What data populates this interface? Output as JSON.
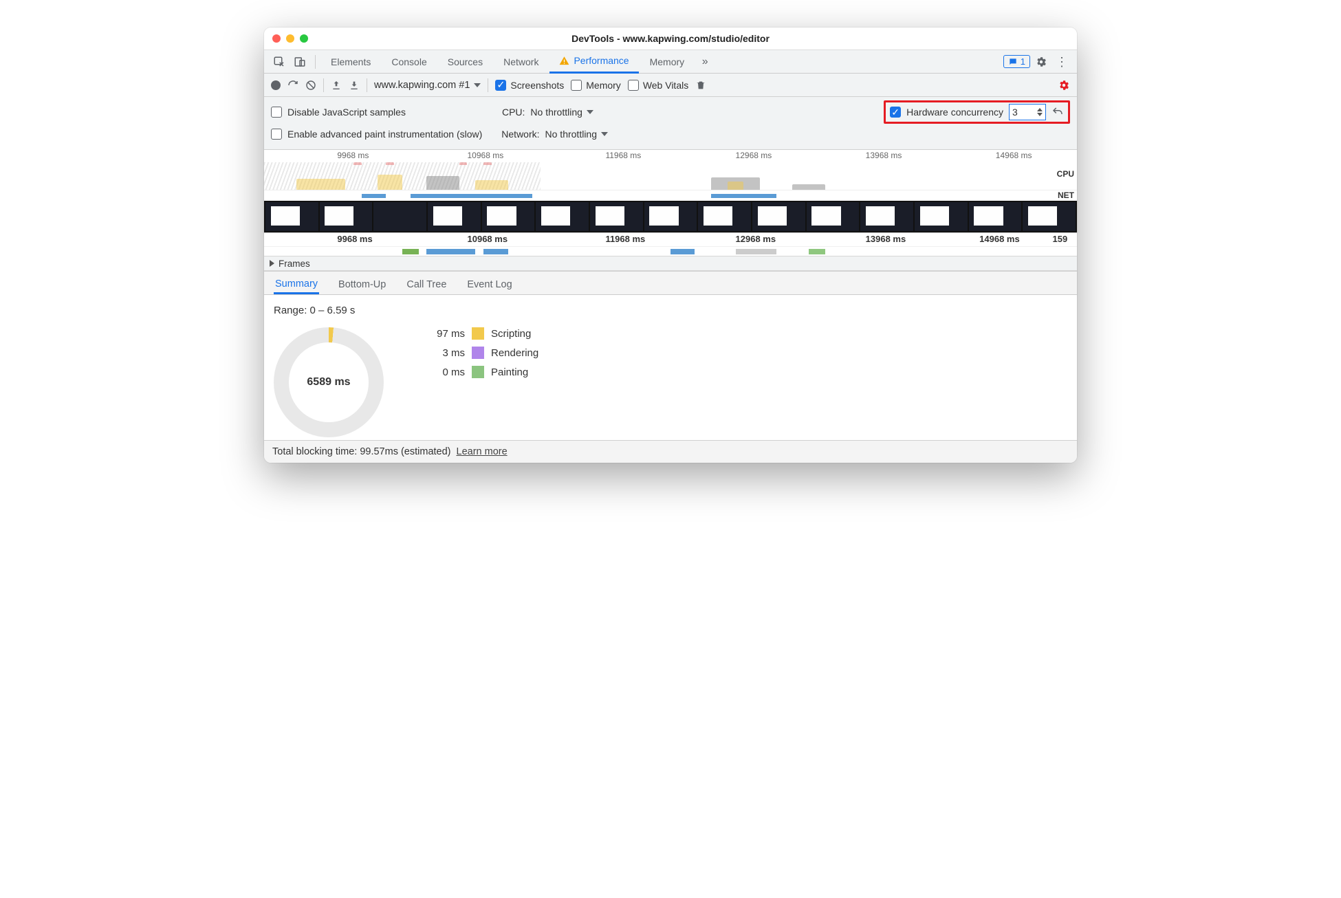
{
  "window": {
    "title": "DevTools - www.kapwing.com/studio/editor"
  },
  "tabs": {
    "items": [
      "Elements",
      "Console",
      "Sources",
      "Network",
      "Performance",
      "Memory"
    ],
    "active": "Performance",
    "badge_count": "1"
  },
  "toolbar": {
    "recording_target": "www.kapwing.com #1",
    "screenshots": {
      "label": "Screenshots",
      "checked": true
    },
    "memory": {
      "label": "Memory",
      "checked": false
    },
    "web_vitals": {
      "label": "Web Vitals",
      "checked": false
    }
  },
  "settings": {
    "disable_js": {
      "label": "Disable JavaScript samples",
      "checked": false
    },
    "cpu_label": "CPU:",
    "cpu_value": "No throttling",
    "hw_concurrency": {
      "label": "Hardware concurrency",
      "checked": true,
      "value": "3"
    },
    "enable_paint": {
      "label": "Enable advanced paint instrumentation (slow)",
      "checked": false
    },
    "network_label": "Network:",
    "network_value": "No throttling"
  },
  "overview": {
    "ticks": [
      "9968 ms",
      "10968 ms",
      "11968 ms",
      "12968 ms",
      "13968 ms",
      "14968 ms"
    ],
    "cpu_label": "CPU",
    "net_label": "NET"
  },
  "detail": {
    "ticks": [
      "9968 ms",
      "10968 ms",
      "11968 ms",
      "12968 ms",
      "13968 ms",
      "14968 ms",
      "159"
    ],
    "frames_label": "Frames"
  },
  "summary_tabs": {
    "items": [
      "Summary",
      "Bottom-Up",
      "Call Tree",
      "Event Log"
    ],
    "active": "Summary"
  },
  "summary": {
    "range": "Range: 0 – 6.59 s",
    "donut_center": "6589 ms",
    "legend": [
      {
        "ms": "97 ms",
        "label": "Scripting",
        "cls": "scripting"
      },
      {
        "ms": "3 ms",
        "label": "Rendering",
        "cls": "rendering"
      },
      {
        "ms": "0 ms",
        "label": "Painting",
        "cls": "painting"
      }
    ]
  },
  "footer": {
    "text": "Total blocking time: 99.57ms (estimated)",
    "link": "Learn more"
  }
}
